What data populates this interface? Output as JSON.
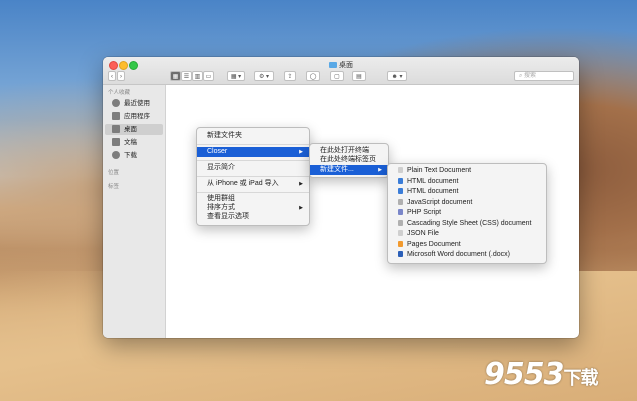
{
  "window": {
    "title": "桌面",
    "search_placeholder": "搜索"
  },
  "sidebar": {
    "favorites_header": "个人收藏",
    "items": [
      {
        "label": "最近使用",
        "icon": "clock-icon"
      },
      {
        "label": "应用程序",
        "icon": "applications-icon"
      },
      {
        "label": "桌面",
        "icon": "desktop-icon",
        "active": true
      },
      {
        "label": "文稿",
        "icon": "documents-icon"
      },
      {
        "label": "下载",
        "icon": "download-icon"
      }
    ],
    "locations_header": "位置",
    "tags_header": "标签"
  },
  "context_menu": {
    "new_folder": "新建文件夹",
    "closer": "Closer",
    "get_info": "显示简介",
    "import": "从 iPhone 或 iPad 导入",
    "use_groups": "使用群组",
    "sort_by": "排序方式",
    "view_options": "查看显示选项"
  },
  "closer_submenu": {
    "open_terminal": "在此处打开终端",
    "open_terminal_tab": "在此处终端标签页",
    "new_file": "新建文件..."
  },
  "new_file_submenu": {
    "items": [
      {
        "label": "Plain Text Document",
        "icon": "text-file-icon",
        "color": "#cfcfcf"
      },
      {
        "label": "HTML document",
        "icon": "html-file-icon",
        "color": "#3b7dd8"
      },
      {
        "label": "HTML document",
        "icon": "html-file-icon",
        "color": "#3b7dd8"
      },
      {
        "label": "JavaScript document",
        "icon": "js-file-icon",
        "color": "#b0b0b0"
      },
      {
        "label": "PHP Script",
        "icon": "php-file-icon",
        "color": "#7a86c9"
      },
      {
        "label": "Cascading Style Sheet (CSS) document",
        "icon": "css-file-icon",
        "color": "#b0b0b0"
      },
      {
        "label": "JSON File",
        "icon": "json-file-icon",
        "color": "#cfcfcf"
      },
      {
        "label": "Pages Document",
        "icon": "pages-file-icon",
        "color": "#f29a2e"
      },
      {
        "label": "Microsoft Word document (.docx)",
        "icon": "word-file-icon",
        "color": "#2b5fb8"
      }
    ]
  },
  "watermark": {
    "text": "9553",
    "suffix": "下载"
  },
  "colors": {
    "highlight": "#1a5fd6"
  }
}
